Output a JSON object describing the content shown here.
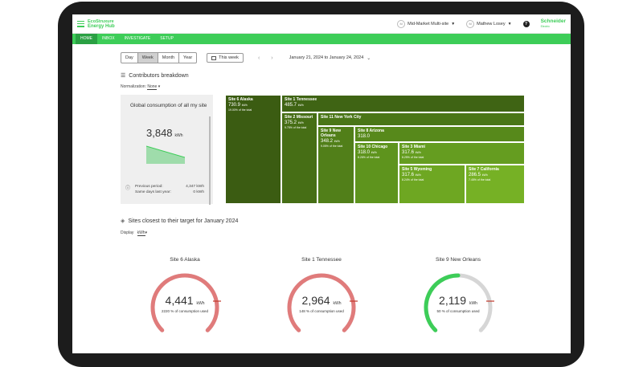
{
  "header": {
    "logo_line1": "EcoStruxure",
    "logo_line2": "Energy Hub",
    "site_selector": "Mid-Market Multi-site",
    "user": "Mathew Losey",
    "help": "?",
    "brand": "Schneider",
    "brand_sub": "Electric"
  },
  "nav": [
    "HOME",
    "INBOX",
    "INVESTIGATE",
    "SETUP"
  ],
  "controls": {
    "periods": [
      "Day",
      "Week",
      "Month",
      "Year"
    ],
    "selected_period": "Week",
    "this_week": "This week",
    "date_range": "January 21, 2024 to January 24, 2024"
  },
  "breakdown": {
    "title": "Contributors breakdown",
    "normalization_label": "Normalization:",
    "normalization_value": "None"
  },
  "global": {
    "title": "Global consumption of all my site",
    "value": "3,848",
    "unit": "kWh",
    "previous_label": "Previous period:",
    "previous_value": "4,347 kWh",
    "same_days_label": "Same days last year:",
    "same_days_value": "0 kWh"
  },
  "treemap": [
    {
      "name": "Site 6 Alaska",
      "value": "730.9",
      "unit": "kWh",
      "pct": "19.00% of the total"
    },
    {
      "name": "Site 1 Tennessee",
      "value": "485.7",
      "unit": "kWh",
      "pct": ""
    },
    {
      "name": "Site 2 Missouri",
      "value": "375.2",
      "unit": "kWh",
      "pct": "9.75% of the total"
    },
    {
      "name": "Site 11 New York City",
      "value": "",
      "unit": "",
      "pct": ""
    },
    {
      "name": "Site 9 New Orleans",
      "value": "348.2",
      "unit": "kWh",
      "pct": "9.05% of the total"
    },
    {
      "name": "Site 8 Arizona",
      "value": "318.0",
      "unit": "",
      "pct": ""
    },
    {
      "name": "Site 10 Chicago",
      "value": "318.0",
      "unit": "kWh",
      "pct": "8.26% of the total"
    },
    {
      "name": "Site 3 Miami",
      "value": "317.6",
      "unit": "kWh",
      "pct": "8.25% of the total"
    },
    {
      "name": "Site 5 Wyoming",
      "value": "317.6",
      "unit": "kWh",
      "pct": "8.24% of the total"
    },
    {
      "name": "Site 7 California",
      "value": "286.5",
      "unit": "kWh",
      "pct": "7.45% of the total"
    }
  ],
  "targets": {
    "title": "Sites closest to their target for January 2024",
    "display_label": "Display",
    "display_value": "kWh",
    "gauges": [
      {
        "name": "Site 6 Alaska",
        "value": "4,441",
        "unit": "kWh",
        "pct_text": "2220 % of consumption used",
        "fill": 1.0,
        "color": "#e07b7b"
      },
      {
        "name": "Site 1 Tennessee",
        "value": "2,964",
        "unit": "kWh",
        "pct_text": "148 % of consumption used",
        "fill": 1.0,
        "color": "#e07b7b"
      },
      {
        "name": "Site 9 New Orleans",
        "value": "2,119",
        "unit": "kWh",
        "pct_text": "50 % of consumption used",
        "fill": 0.5,
        "color": "#3dcd58"
      }
    ]
  },
  "colors": {
    "accent": "#3dcd58",
    "over_target": "#e07b7b",
    "track": "#d6d6d6"
  }
}
